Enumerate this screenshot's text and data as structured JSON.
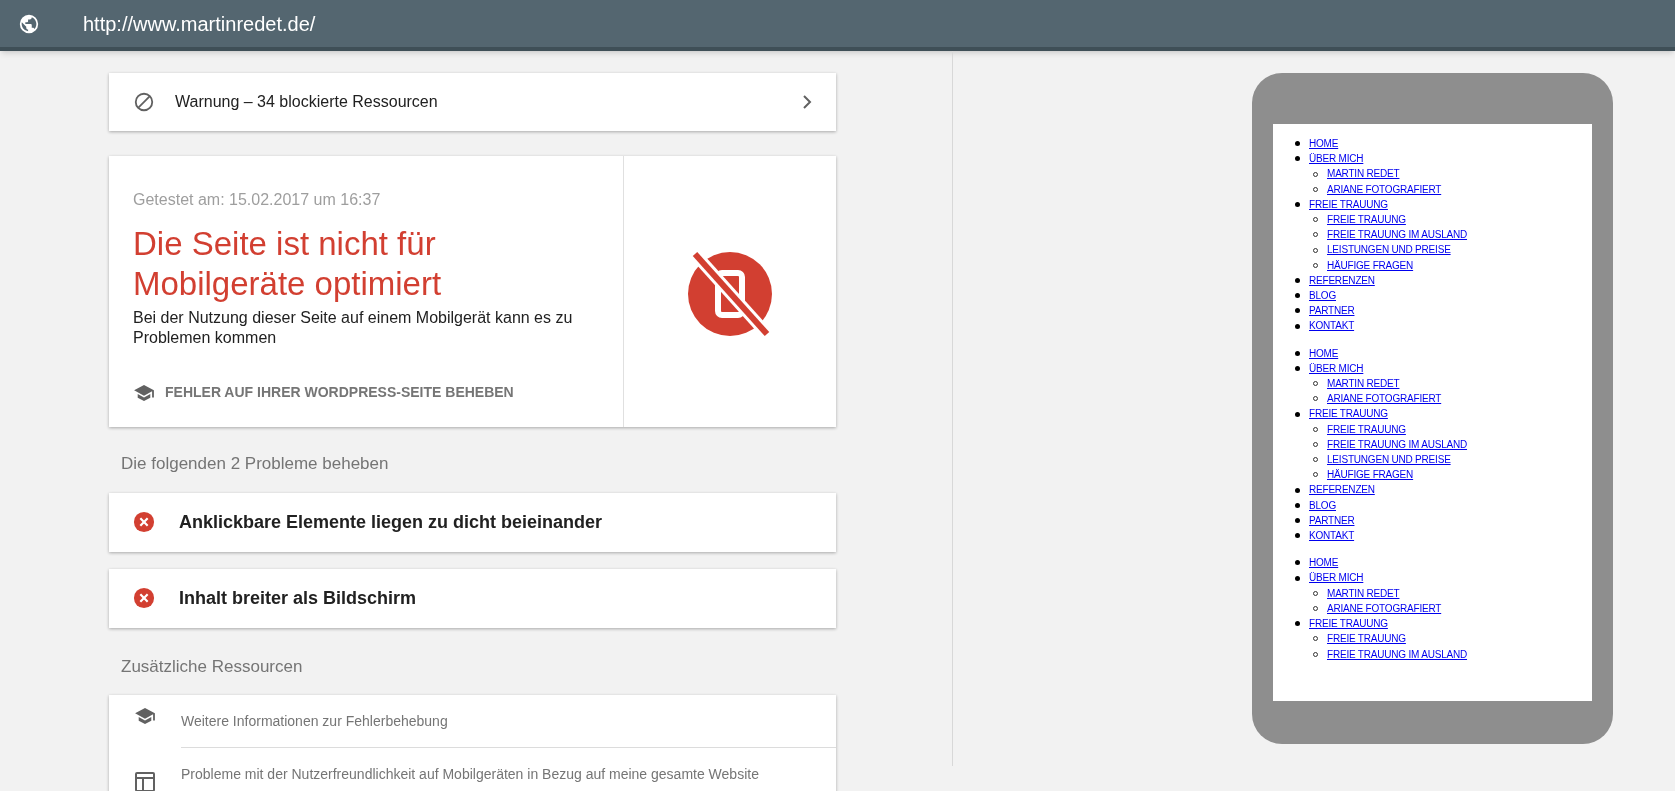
{
  "address_bar": {
    "url": "http://www.martinredet.de/"
  },
  "warning": {
    "text": "Warnung – 34 blockierte Ressourcen"
  },
  "result": {
    "tested": "Getestet am: 15.02.2017 um 16:37",
    "title": "Die Seite ist nicht für Mobilgeräte optimiert",
    "description": "Bei der Nutzung dieser Seite auf einem Mobilgerät kann es zu Problemen kommen",
    "link": "FEHLER AUF IHRER WORDPRESS-SEITE BEHEBEN"
  },
  "problems_heading": "Die folgenden 2 Probleme beheben",
  "problems": [
    {
      "text": "Anklickbare Elemente liegen zu dicht beieinander"
    },
    {
      "text": "Inhalt breiter als Bildschirm"
    }
  ],
  "resources_heading": "Zusätzliche Ressourcen",
  "resources": [
    {
      "kind": "school",
      "text": "Weitere Informationen zur Fehlerbehebung"
    },
    {
      "kind": "layout",
      "text": "Probleme mit der Nutzerfreundlichkeit auf Mobilgeräten in Bezug auf meine gesamte Website"
    }
  ],
  "phone_preview": {
    "menus": [
      {
        "items": [
          {
            "label": "HOME"
          },
          {
            "label": "ÜBER MICH",
            "children": [
              {
                "label": "MARTIN REDET"
              },
              {
                "label": "ARIANE FOTOGRAFIERT"
              }
            ]
          },
          {
            "label": "FREIE TRAUUNG",
            "children": [
              {
                "label": "FREIE TRAUUNG"
              },
              {
                "label": "FREIE TRAUUNG IM AUSLAND"
              },
              {
                "label": "LEISTUNGEN UND PREISE"
              },
              {
                "label": "HÄUFIGE FRAGEN"
              }
            ]
          },
          {
            "label": "REFERENZEN"
          },
          {
            "label": "BLOG"
          },
          {
            "label": "PARTNER"
          },
          {
            "label": "KONTAKT"
          }
        ]
      },
      {
        "items": [
          {
            "label": "HOME"
          },
          {
            "label": "ÜBER MICH",
            "children": [
              {
                "label": "MARTIN REDET"
              },
              {
                "label": "ARIANE FOTOGRAFIERT"
              }
            ]
          },
          {
            "label": "FREIE TRAUUNG",
            "children": [
              {
                "label": "FREIE TRAUUNG"
              },
              {
                "label": "FREIE TRAUUNG IM AUSLAND"
              },
              {
                "label": "LEISTUNGEN UND PREISE"
              },
              {
                "label": "HÄUFIGE FRAGEN"
              }
            ]
          },
          {
            "label": "REFERENZEN"
          },
          {
            "label": "BLOG"
          },
          {
            "label": "PARTNER"
          },
          {
            "label": "KONTAKT"
          }
        ]
      },
      {
        "items": [
          {
            "label": "HOME"
          },
          {
            "label": "ÜBER MICH",
            "children": [
              {
                "label": "MARTIN REDET"
              },
              {
                "label": "ARIANE FOTOGRAFIERT"
              }
            ]
          },
          {
            "label": "FREIE TRAUUNG",
            "children": [
              {
                "label": "FREIE TRAUUNG"
              },
              {
                "label": "FREIE TRAUUNG IM AUSLAND"
              }
            ]
          }
        ]
      }
    ]
  }
}
